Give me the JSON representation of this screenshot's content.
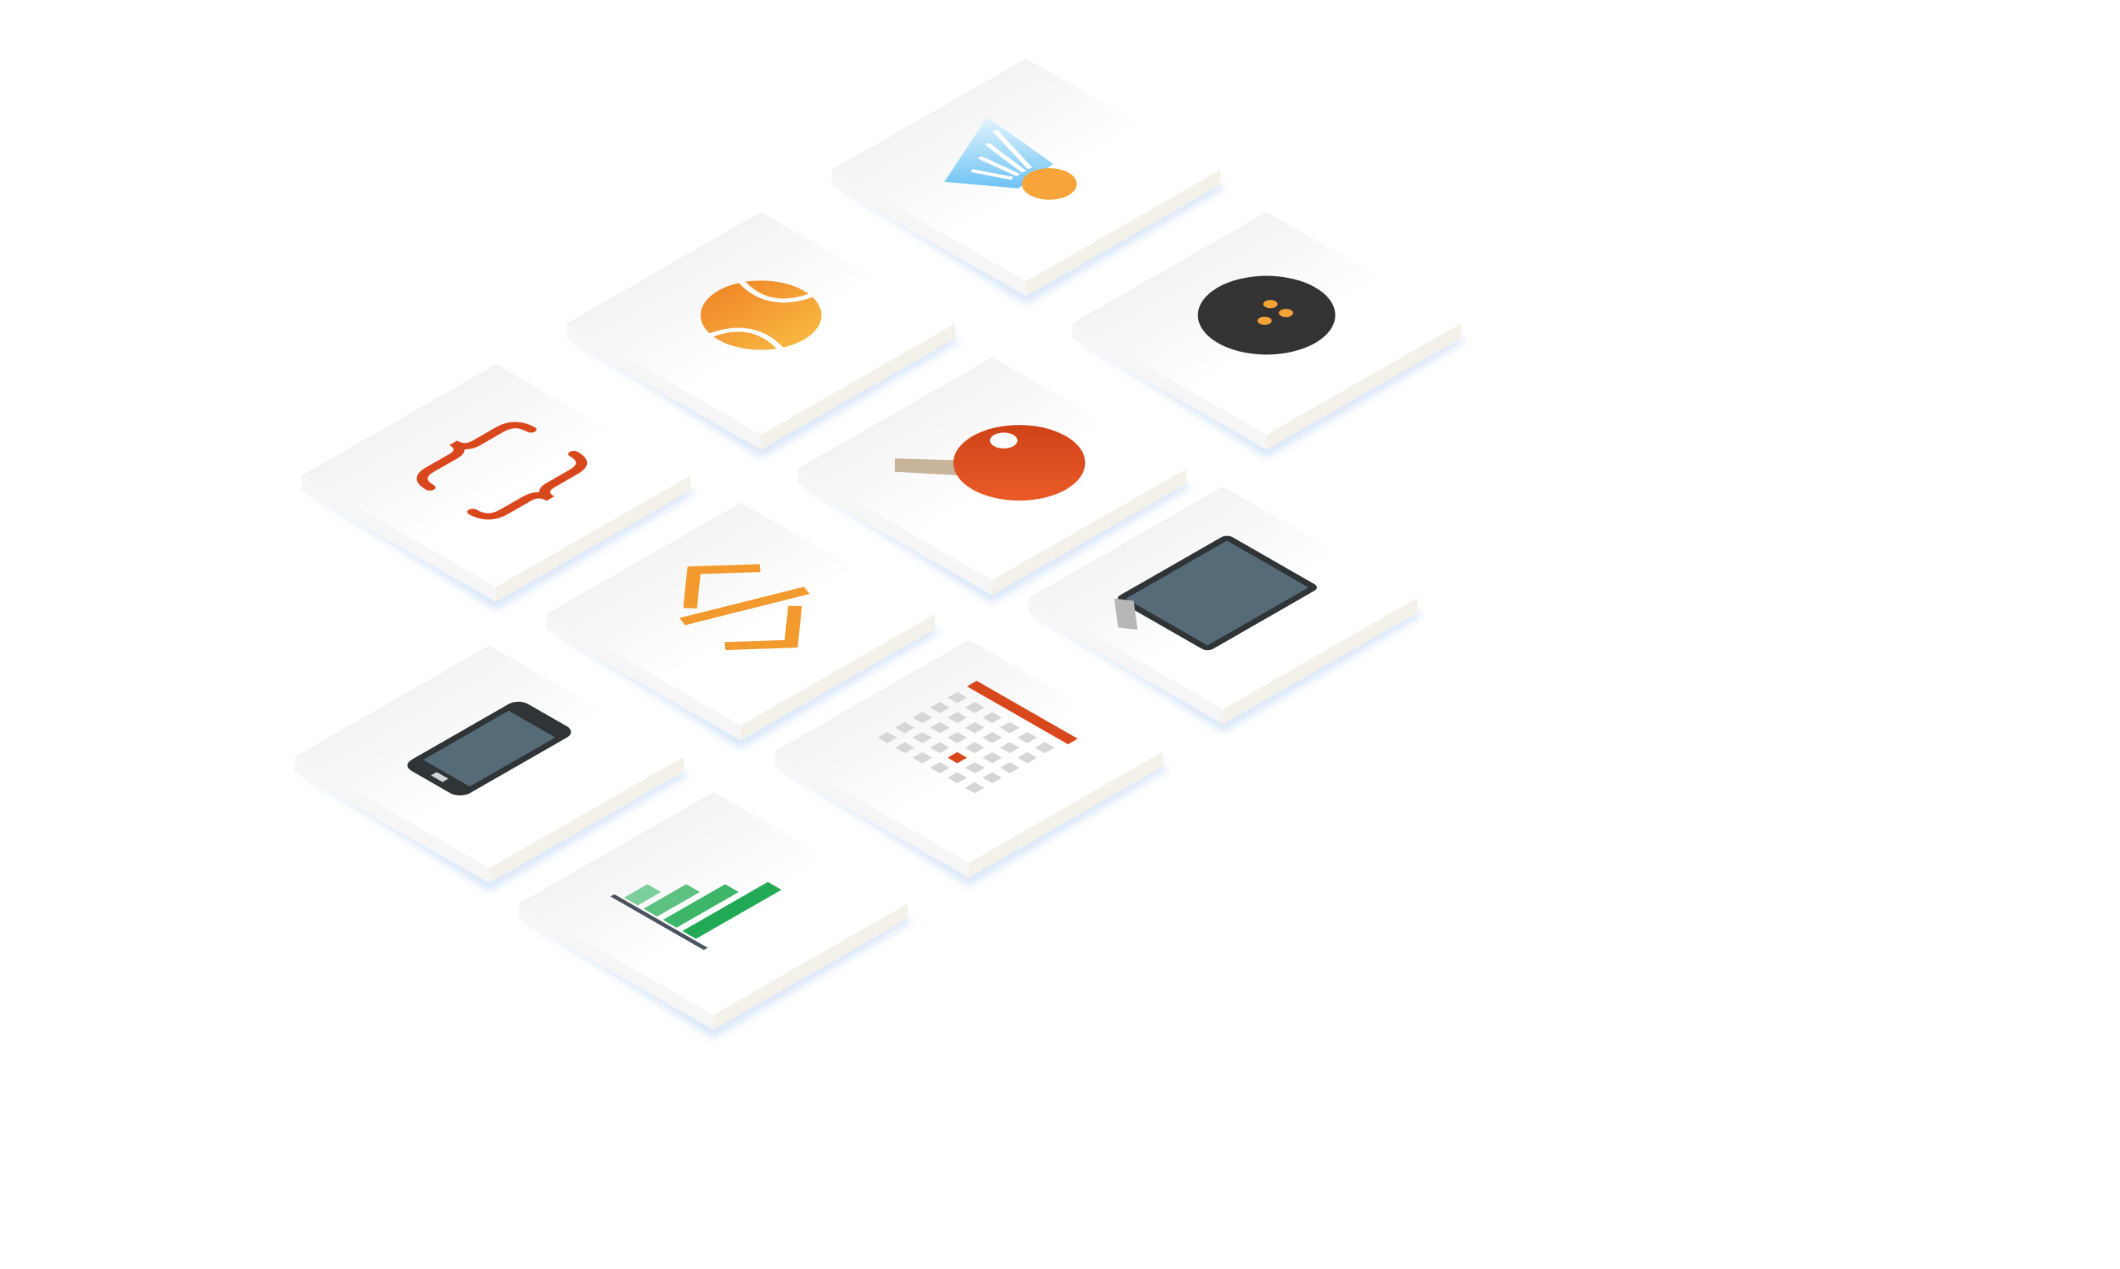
{
  "scene": {
    "background": "#ffffff",
    "tile_top_light": "#ffffff",
    "tile_top_dark": "#ececec",
    "tile_side": "#f3f1ea",
    "tile_shadow": "#bcd4f5"
  },
  "tiles": [
    {
      "icon": "badminton-shuttlecock-icon",
      "colors": {
        "cork": "#f7a43a",
        "feathers": "#7cc8f5"
      }
    },
    {
      "icon": "tennis-ball-icon",
      "colors": {
        "ball": "#f5a236",
        "seam": "#ffffff"
      }
    },
    {
      "icon": "bowling-ball-icon",
      "colors": {
        "ball": "#333333",
        "holes": "#f5a236"
      }
    },
    {
      "icon": "curly-braces-icon",
      "colors": {
        "braces": "#d9481c"
      }
    },
    {
      "icon": "ping-pong-paddle-icon",
      "colors": {
        "paddle": "#e04e1f",
        "handle": "#c8b49a",
        "ball": "#ffffff"
      }
    },
    {
      "icon": "code-tag-icon",
      "colors": {
        "tag": "#f29a2e"
      }
    },
    {
      "icon": "tablet-icon",
      "colors": {
        "frame": "#2f3437",
        "screen": "#566b78",
        "stand": "#b7b7b7"
      }
    },
    {
      "icon": "smartphone-icon",
      "colors": {
        "frame": "#2f3437",
        "screen": "#566b78"
      }
    },
    {
      "icon": "calendar-icon",
      "colors": {
        "header": "#d9481c",
        "cells": "#d6d6d6",
        "highlight": "#d9481c"
      }
    },
    {
      "icon": "bar-chart-icon",
      "colors": {
        "bars": [
          "#7ccf9a",
          "#5cc181",
          "#3db66a",
          "#22a955"
        ],
        "axis": "#4a5560"
      }
    }
  ]
}
